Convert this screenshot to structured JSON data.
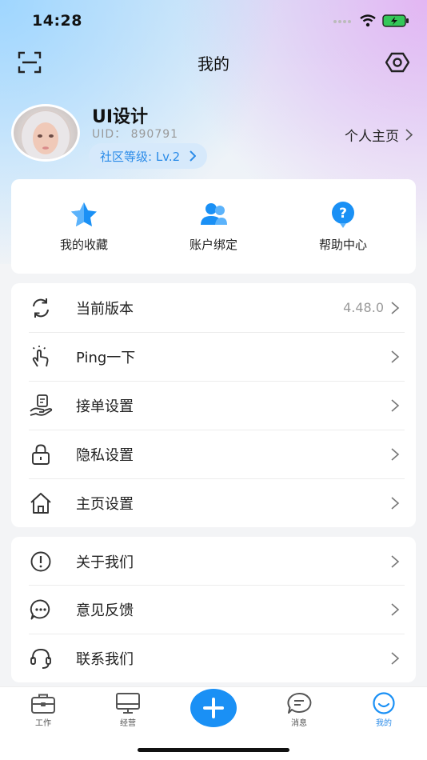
{
  "status": {
    "time": "14:28"
  },
  "nav": {
    "title": "我的"
  },
  "profile": {
    "name": "UI设计",
    "uid": "UID：  890791",
    "level": "社区等级: Lv.2",
    "homepage": "个人主页"
  },
  "quick_actions": [
    {
      "label": "我的收藏",
      "icon": "star-icon"
    },
    {
      "label": "账户绑定",
      "icon": "users-icon"
    },
    {
      "label": "帮助中心",
      "icon": "help-icon"
    }
  ],
  "menu": [
    {
      "label": "当前版本",
      "value": "4.48.0",
      "icon": "refresh-icon"
    },
    {
      "label": "Ping一下",
      "icon": "tap-icon"
    },
    {
      "label": "接单设置",
      "icon": "order-hand-icon"
    },
    {
      "label": "隐私设置",
      "icon": "lock-icon"
    },
    {
      "label": "主页设置",
      "icon": "home-icon"
    },
    {
      "label": "关于我们",
      "icon": "info-circle-icon"
    },
    {
      "label": "意见反馈",
      "icon": "chat-dots-icon"
    },
    {
      "label": "联系我们",
      "icon": "headset-icon"
    }
  ],
  "tabs": [
    {
      "label": "工作",
      "icon": "briefcase-icon"
    },
    {
      "label": "经营",
      "icon": "monitor-icon"
    },
    {
      "label": "",
      "icon": "plus-icon"
    },
    {
      "label": "消息",
      "icon": "message-icon"
    },
    {
      "label": "我的",
      "icon": "smile-icon",
      "active": true
    }
  ],
  "colors": {
    "accent": "#1a90f5",
    "level_bg": "#d6e9fb"
  }
}
